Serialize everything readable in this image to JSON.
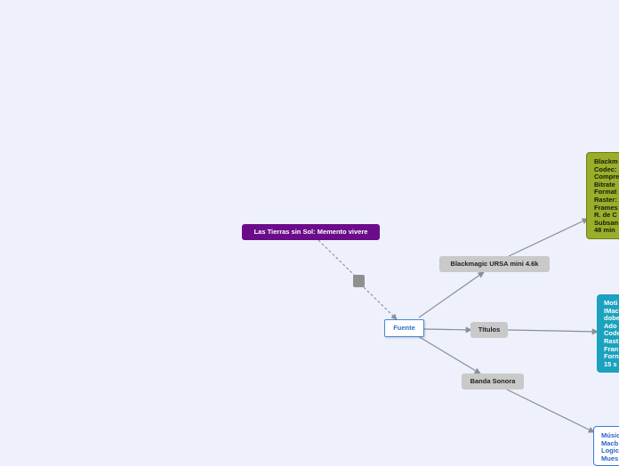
{
  "colors": {
    "background": "#eef1fb",
    "root": "#6b0c8a",
    "hub": "#8f8f8f",
    "subtopic": "#c9c9c9",
    "green_note": "#9aae2a",
    "teal_note": "#1aa2bf",
    "blue_border": "#3c7ad6",
    "connector": "#9a9eaa"
  },
  "map": {
    "root": {
      "label": "Las Tierras sin Sol: Memento vivere"
    },
    "center": {
      "label": "Fuente"
    },
    "branches": [
      {
        "label": "Blackmagic URSA mini 4.6k",
        "note": [
          "Blackm",
          "Codec:",
          "Compre",
          "Bitrate",
          "Format",
          "Raster:",
          "Frames",
          "R. de C",
          "Subsan",
          "48 min"
        ]
      },
      {
        "label": "Títulos",
        "note": [
          "Moti",
          "IMac",
          "dobe",
          "Ado",
          "Code",
          "Rast",
          "Fran",
          "Forn",
          "15 s"
        ]
      },
      {
        "label": "Banda Sonora",
        "note": [
          "Músic",
          "Macb",
          "Logic",
          "Mues"
        ]
      }
    ]
  }
}
